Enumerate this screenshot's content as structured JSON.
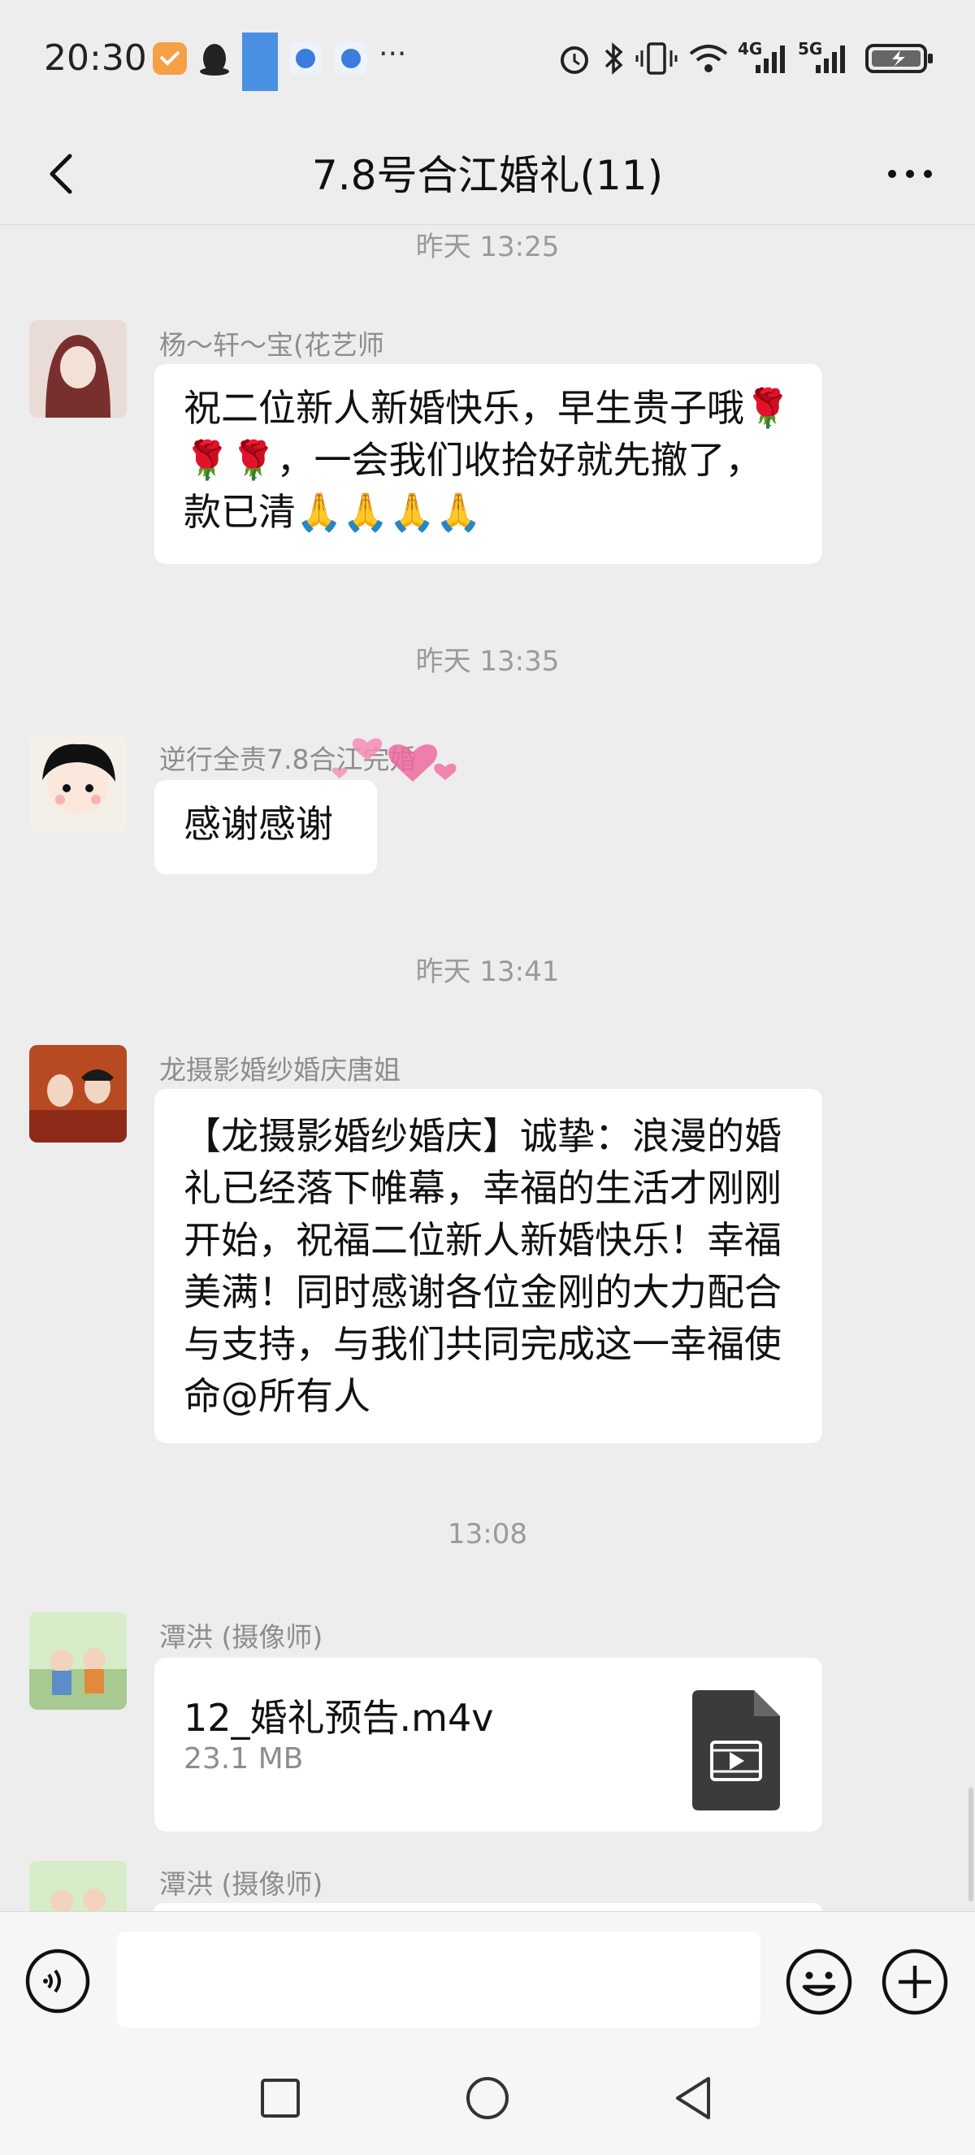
{
  "status_bar": {
    "time": "20:30",
    "network_1": "4G",
    "network_2": "5G",
    "more": "···"
  },
  "header": {
    "title": "7.8号合江婚礼(11)",
    "back_icon": "chevron-left-icon",
    "more_icon": "more-horizontal-icon"
  },
  "messages": [
    {
      "timestamp": "昨天 13:25",
      "sender": "杨～轩～宝(花艺师",
      "text": "祝二位新人新婚快乐，早生贵子哦🌹🌹🌹，一会我们收拾好就先撤了，款已清🙏🙏🙏🙏"
    },
    {
      "timestamp": "昨天 13:35",
      "sender": "逆行全责7.8合江完婚",
      "text": "感谢感谢"
    },
    {
      "timestamp": "昨天 13:41",
      "sender": "龙摄影婚纱婚庆唐姐",
      "text": "【龙摄影婚纱婚庆】诚挚：浪漫的婚礼已经落下帷幕，幸福的生活才刚刚开始，祝福二位新人新婚快乐！幸福美满！同时感谢各位金刚的大力配合与支持，与我们共同完成这一幸福使命@所有人"
    },
    {
      "timestamp": "13:08",
      "sender": "潭洪 (摄像师)",
      "file_name": "12_婚礼预告.m4v",
      "file_size": "23.1 MB"
    },
    {
      "sender": "潭洪 (摄像师)"
    }
  ],
  "input_bar": {
    "placeholder": "",
    "voice_icon": "voice-icon",
    "emoji_icon": "emoji-icon",
    "plus_icon": "plus-icon"
  },
  "nav_bar": {
    "icons": [
      "recent-apps-icon",
      "home-icon",
      "back-icon"
    ]
  },
  "colors": {
    "background": "#ededed",
    "bubble": "#ffffff",
    "meta_text": "#8d8d8d"
  }
}
